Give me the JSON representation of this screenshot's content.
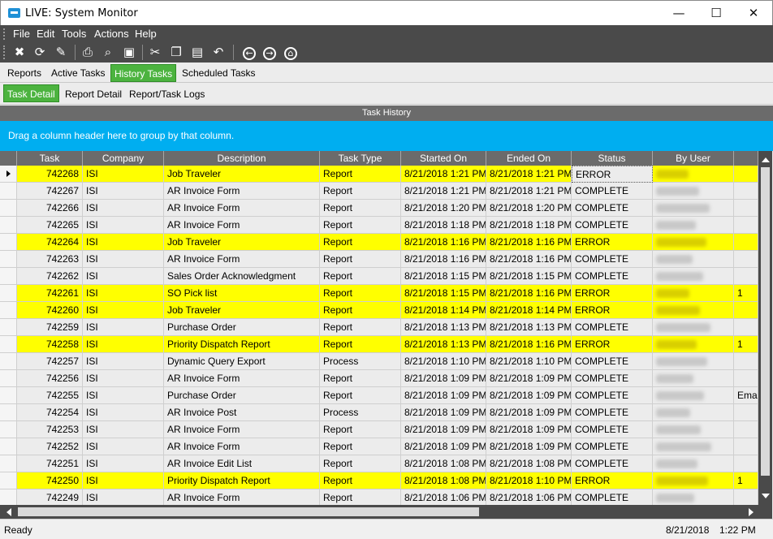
{
  "window": {
    "title": "LIVE: System Monitor",
    "minimize": "—",
    "maximize": "☐",
    "close": "✕"
  },
  "menu": [
    "File",
    "Edit",
    "Tools",
    "Actions",
    "Help"
  ],
  "toolbar_icons": [
    "close-icon",
    "refresh-icon",
    "clear-icon",
    "print-icon",
    "print-preview-icon",
    "save-icon",
    "cut-icon",
    "copy-icon",
    "paste-icon",
    "undo-icon",
    "back-icon",
    "forward-icon",
    "home-icon"
  ],
  "tabs_main": [
    "Reports",
    "Active Tasks",
    "History Tasks",
    "Scheduled Tasks"
  ],
  "tabs_main_active": "History Tasks",
  "tabs_sub": [
    "Task Detail",
    "Report Detail",
    "Report/Task Logs"
  ],
  "tabs_sub_active": "Task Detail",
  "panel_title": "Task History",
  "group_hint": "Drag a column header here to group by that column.",
  "columns": [
    "Task",
    "Company",
    "Description",
    "Task Type",
    "Started On",
    "Ended On",
    "Status",
    "By User"
  ],
  "rows": [
    {
      "task": "742268",
      "company": "ISI",
      "desc": "Job Traveler",
      "type": "Report",
      "start": "8/21/2018 1:21 PM",
      "end": "8/21/2018 1:21 PM",
      "status": "ERROR",
      "extra": ""
    },
    {
      "task": "742267",
      "company": "ISI",
      "desc": "AR Invoice Form",
      "type": "Report",
      "start": "8/21/2018 1:21 PM",
      "end": "8/21/2018 1:21 PM",
      "status": "COMPLETE",
      "extra": ""
    },
    {
      "task": "742266",
      "company": "ISI",
      "desc": "AR Invoice Form",
      "type": "Report",
      "start": "8/21/2018 1:20 PM",
      "end": "8/21/2018 1:20 PM",
      "status": "COMPLETE",
      "extra": ""
    },
    {
      "task": "742265",
      "company": "ISI",
      "desc": "AR Invoice Form",
      "type": "Report",
      "start": "8/21/2018 1:18 PM",
      "end": "8/21/2018 1:18 PM",
      "status": "COMPLETE",
      "extra": ""
    },
    {
      "task": "742264",
      "company": "ISI",
      "desc": "Job Traveler",
      "type": "Report",
      "start": "8/21/2018 1:16 PM",
      "end": "8/21/2018 1:16 PM",
      "status": "ERROR",
      "extra": ""
    },
    {
      "task": "742263",
      "company": "ISI",
      "desc": "AR Invoice Form",
      "type": "Report",
      "start": "8/21/2018 1:16 PM",
      "end": "8/21/2018 1:16 PM",
      "status": "COMPLETE",
      "extra": ""
    },
    {
      "task": "742262",
      "company": "ISI",
      "desc": "Sales Order Acknowledgment",
      "type": "Report",
      "start": "8/21/2018 1:15 PM",
      "end": "8/21/2018 1:15 PM",
      "status": "COMPLETE",
      "extra": ""
    },
    {
      "task": "742261",
      "company": "ISI",
      "desc": "SO Pick list",
      "type": "Report",
      "start": "8/21/2018 1:15 PM",
      "end": "8/21/2018 1:16 PM",
      "status": "ERROR",
      "extra": "1"
    },
    {
      "task": "742260",
      "company": "ISI",
      "desc": "Job Traveler",
      "type": "Report",
      "start": "8/21/2018 1:14 PM",
      "end": "8/21/2018 1:14 PM",
      "status": "ERROR",
      "extra": ""
    },
    {
      "task": "742259",
      "company": "ISI",
      "desc": "Purchase Order",
      "type": "Report",
      "start": "8/21/2018 1:13 PM",
      "end": "8/21/2018 1:13 PM",
      "status": "COMPLETE",
      "extra": ""
    },
    {
      "task": "742258",
      "company": "ISI",
      "desc": "Priority Dispatch Report",
      "type": "Report",
      "start": "8/21/2018 1:13 PM",
      "end": "8/21/2018 1:16 PM",
      "status": "ERROR",
      "extra": "1"
    },
    {
      "task": "742257",
      "company": "ISI",
      "desc": "Dynamic Query Export",
      "type": "Process",
      "start": "8/21/2018 1:10 PM",
      "end": "8/21/2018 1:10 PM",
      "status": "COMPLETE",
      "extra": ""
    },
    {
      "task": "742256",
      "company": "ISI",
      "desc": "AR Invoice Form",
      "type": "Report",
      "start": "8/21/2018 1:09 PM",
      "end": "8/21/2018 1:09 PM",
      "status": "COMPLETE",
      "extra": ""
    },
    {
      "task": "742255",
      "company": "ISI",
      "desc": "Purchase Order",
      "type": "Report",
      "start": "8/21/2018 1:09 PM",
      "end": "8/21/2018 1:09 PM",
      "status": "COMPLETE",
      "extra": "Emai"
    },
    {
      "task": "742254",
      "company": "ISI",
      "desc": "AR Invoice Post",
      "type": "Process",
      "start": "8/21/2018 1:09 PM",
      "end": "8/21/2018 1:09 PM",
      "status": "COMPLETE",
      "extra": ""
    },
    {
      "task": "742253",
      "company": "ISI",
      "desc": "AR Invoice Form",
      "type": "Report",
      "start": "8/21/2018 1:09 PM",
      "end": "8/21/2018 1:09 PM",
      "status": "COMPLETE",
      "extra": ""
    },
    {
      "task": "742252",
      "company": "ISI",
      "desc": "AR Invoice Form",
      "type": "Report",
      "start": "8/21/2018 1:09 PM",
      "end": "8/21/2018 1:09 PM",
      "status": "COMPLETE",
      "extra": ""
    },
    {
      "task": "742251",
      "company": "ISI",
      "desc": "AR Invoice Edit List",
      "type": "Report",
      "start": "8/21/2018 1:08 PM",
      "end": "8/21/2018 1:08 PM",
      "status": "COMPLETE",
      "extra": ""
    },
    {
      "task": "742250",
      "company": "ISI",
      "desc": "Priority Dispatch Report",
      "type": "Report",
      "start": "8/21/2018 1:08 PM",
      "end": "8/21/2018 1:10 PM",
      "status": "ERROR",
      "extra": "1"
    },
    {
      "task": "742249",
      "company": "ISI",
      "desc": "AR Invoice Form",
      "type": "Report",
      "start": "8/21/2018 1:06 PM",
      "end": "8/21/2018 1:06 PM",
      "status": "COMPLETE",
      "extra": ""
    }
  ],
  "status": {
    "text": "Ready",
    "date": "8/21/2018",
    "time": "1:22 PM"
  },
  "colors": {
    "error_row": "#ffff00",
    "active_tab": "#4cb33f",
    "group_bar": "#00aef0",
    "chrome": "#4a4a4a"
  }
}
